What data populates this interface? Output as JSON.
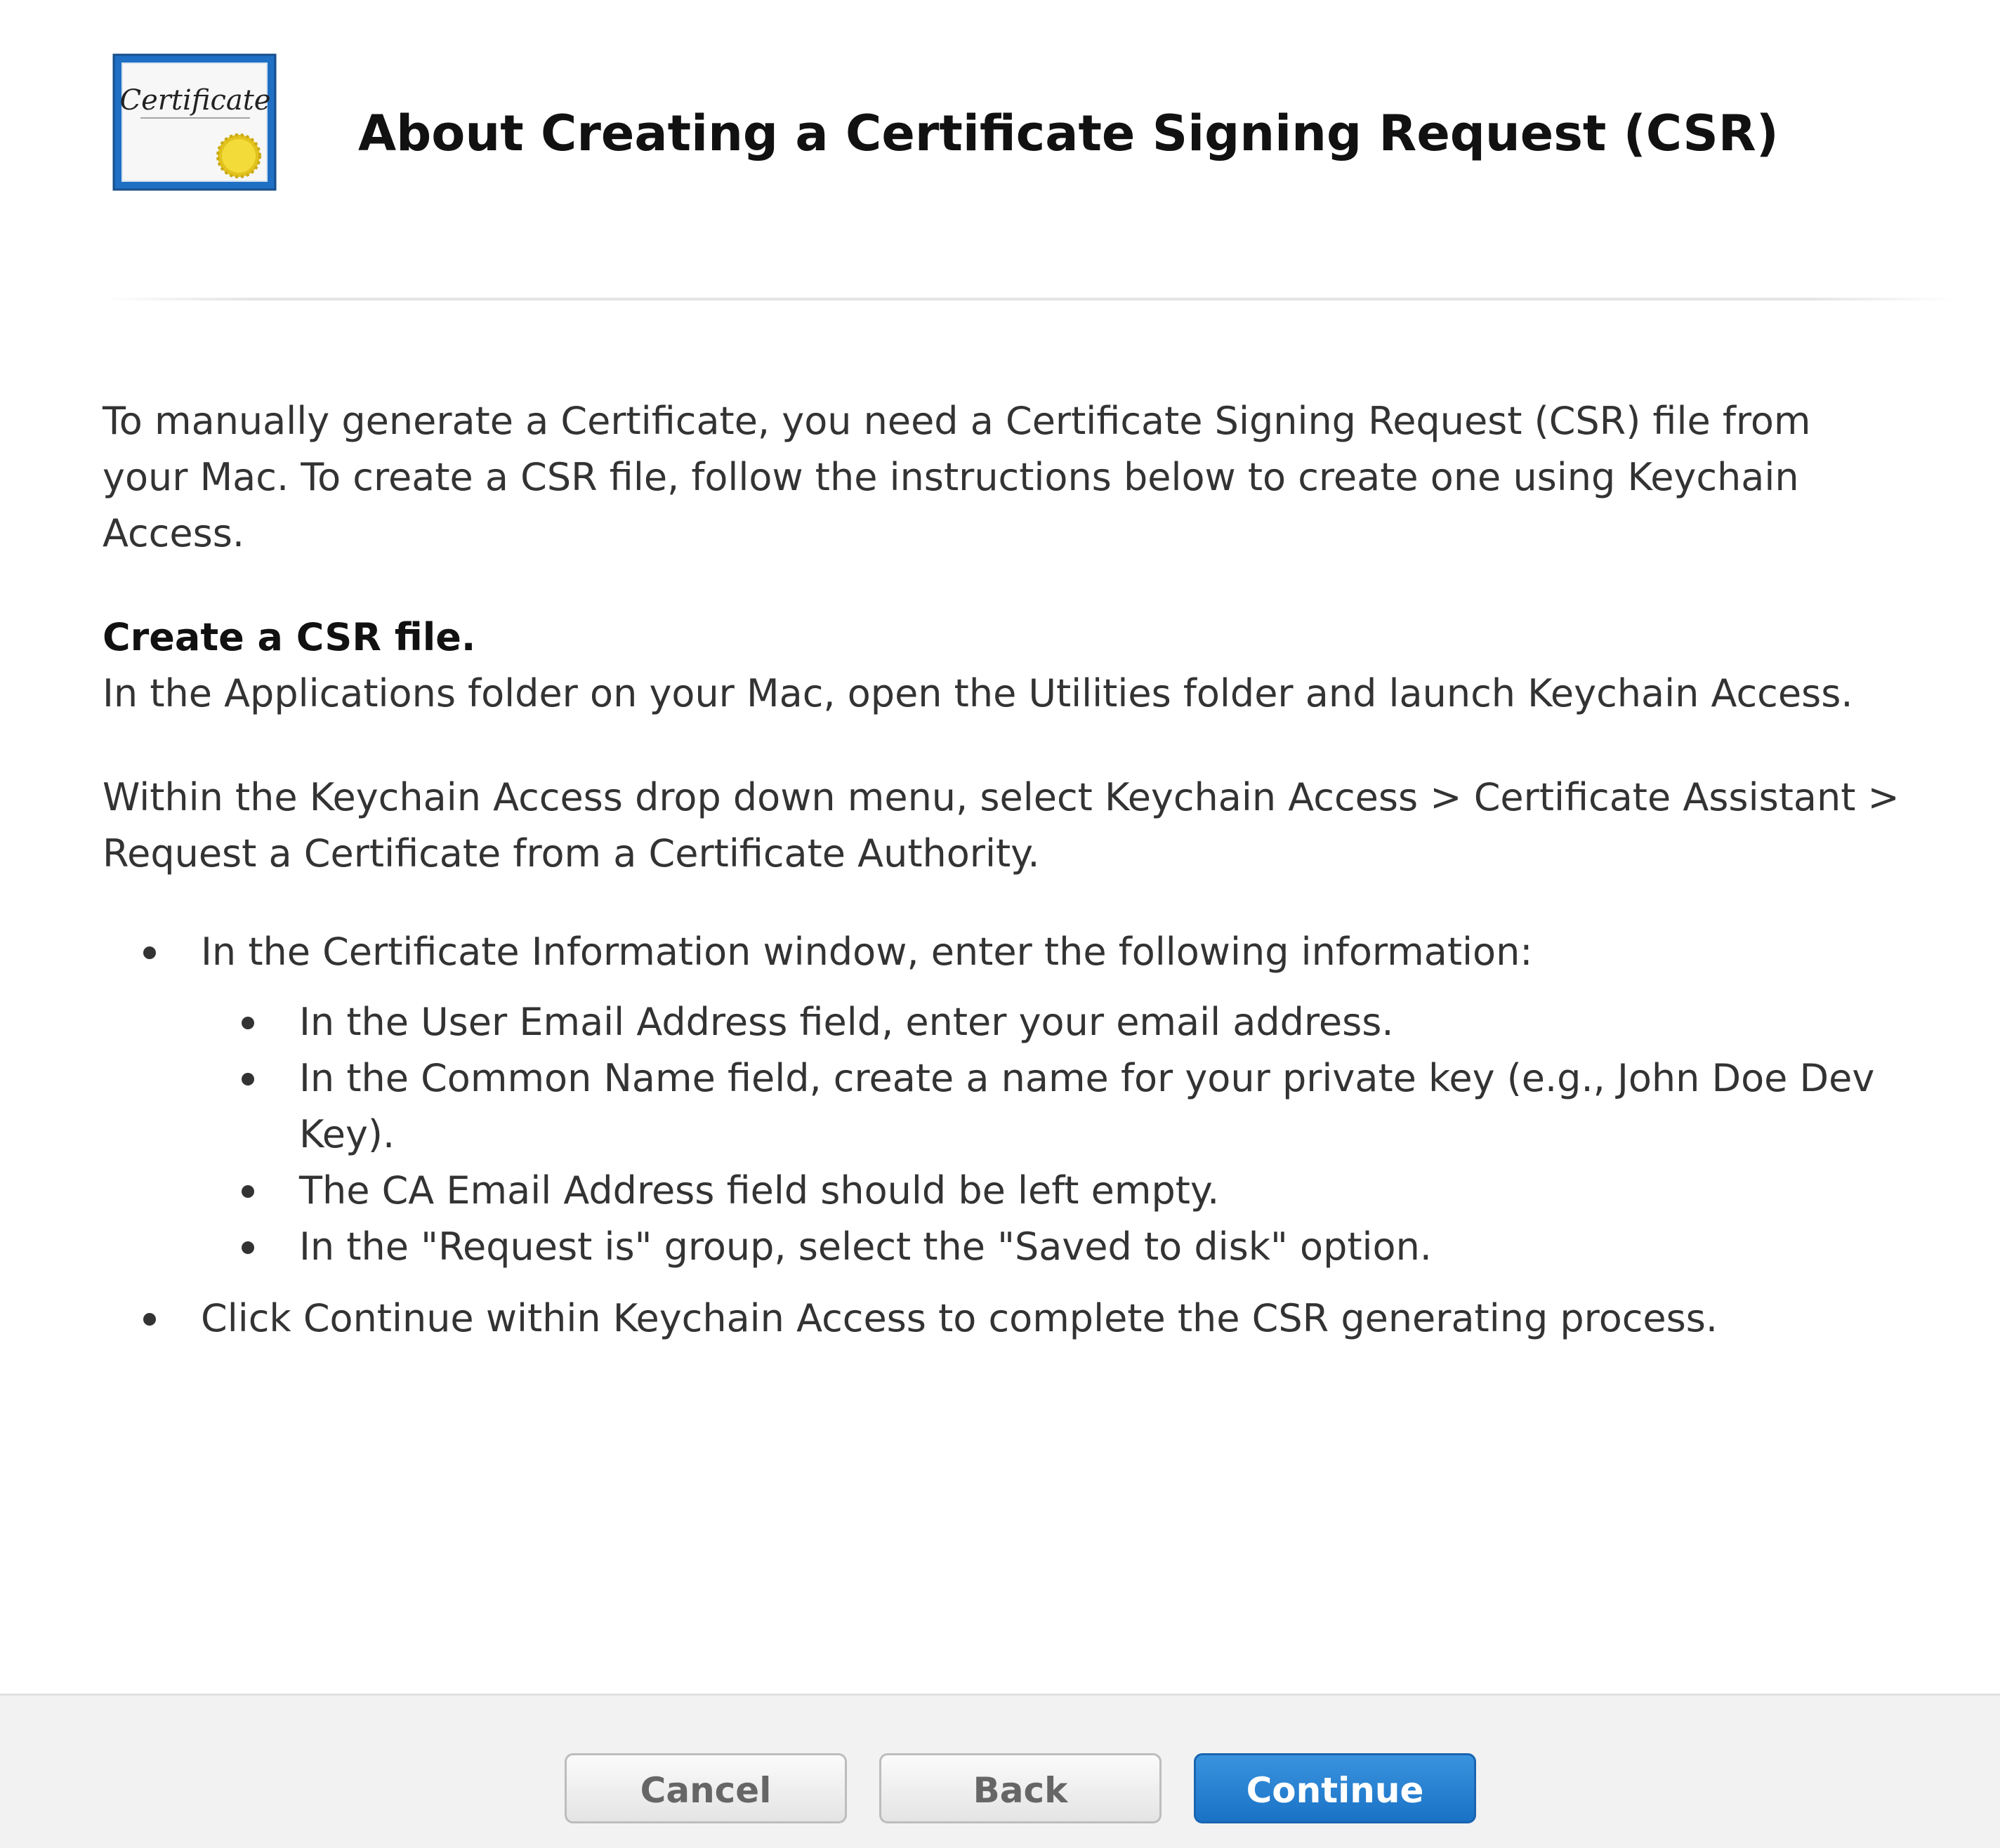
{
  "header": {
    "icon": "certificate-icon",
    "icon_text": "Certificate",
    "title": "About Creating a Certificate Signing Request (CSR)"
  },
  "content": {
    "intro": "To manually generate a Certificate, you need a Certificate Signing Request (CSR) file from your Mac. To create a CSR file, follow the instructions below to create one using Keychain Access.",
    "section_heading": "Create a CSR file.",
    "step_1": "In the Applications folder on your Mac, open the Utilities folder and launch Keychain Access.",
    "step_2": "Within the Keychain Access drop down menu, select Keychain Access > Certificate Assistant > Request a Certificate from a Certificate Authority.",
    "bullets": [
      {
        "text": "In the Certificate Information window, enter the following information:",
        "sub": [
          "In the User Email Address field, enter your email address.",
          "In the Common Name field, create a name for your private key (e.g., John Doe Dev Key).",
          "The CA Email Address field should be left empty.",
          "In the \"Request is\" group, select the \"Saved to disk\" option."
        ]
      },
      {
        "text": "Click Continue within Keychain Access to complete the CSR generating process."
      }
    ]
  },
  "footer": {
    "cancel_label": "Cancel",
    "back_label": "Back",
    "continue_label": "Continue"
  },
  "colors": {
    "primary_button": "#1f7bd0",
    "footer_background": "#f2f2f2",
    "certificate_frame": "#1f6fc4",
    "seal": "#f0d030"
  }
}
